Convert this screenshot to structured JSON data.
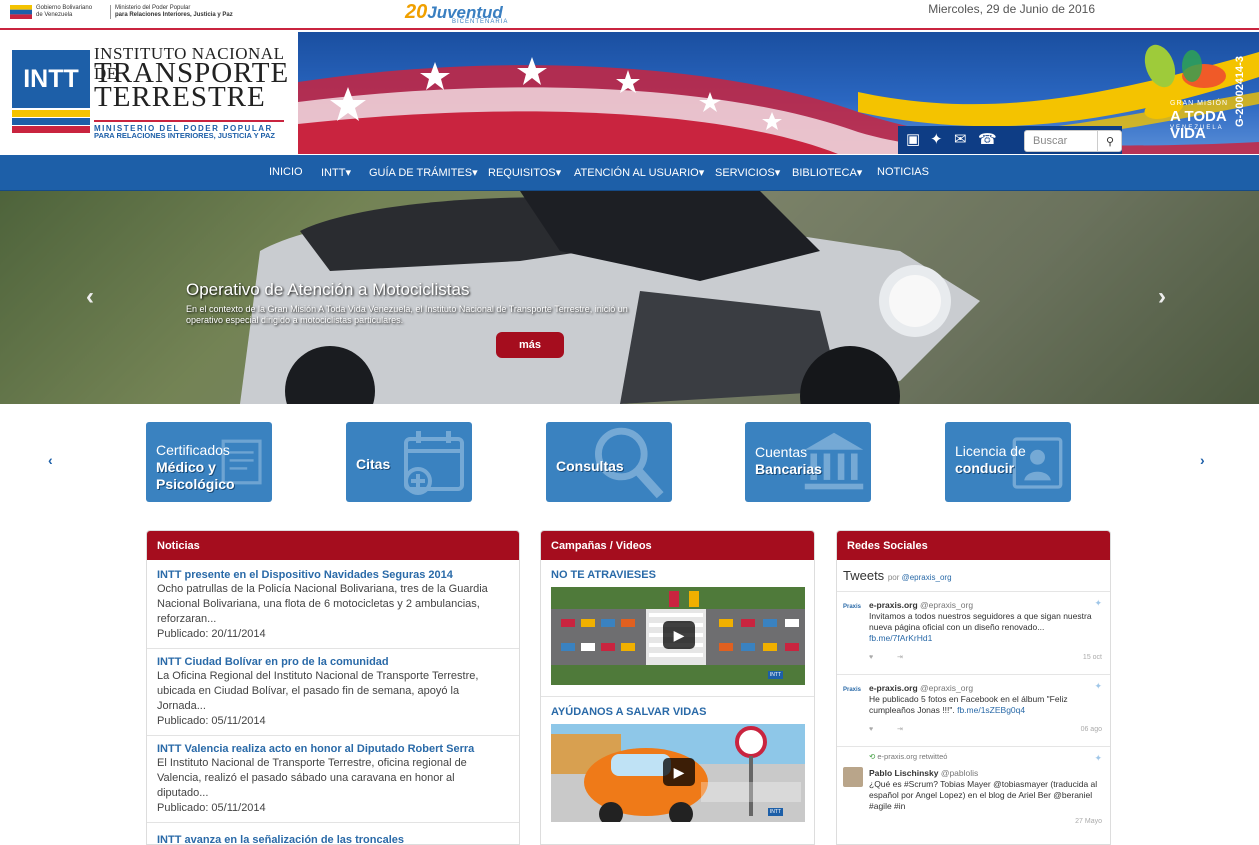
{
  "topbar": {
    "gov_line1": "Gobierno Bolivariano",
    "gov_line2": "de Venezuela",
    "ministry_line1": "Ministerio del Poder Popular",
    "ministry_line2": "para Relaciones Interiores, Justicia y Paz",
    "juventud_20": "20",
    "juventud": "Juventud",
    "bicentenaria": "BICENTENARIA",
    "date": "Miercoles, 29 de Junio de 2016"
  },
  "logo": {
    "acronym": "INTT",
    "line1": "INSTITUTO NACIONAL DE",
    "line2": "TRANSPORTE",
    "line3": "TERRESTRE",
    "line4": "MINISTERIO DEL PODER POPULAR",
    "line5": "PARA RELACIONES INTERIORES, JUSTICIA Y PAZ"
  },
  "banner": {
    "search_placeholder": "Buscar",
    "gm_line1": "GRAN MISIÓN",
    "gm_line2": "A TODA VIDA",
    "gm_line3": "VENEZUELA",
    "code": "G-20002414-3"
  },
  "nav": {
    "items": [
      "INICIO",
      "INTT",
      "GUÍA DE TRÁMITES",
      "REQUISITOS",
      "ATENCIÓN AL USUARIO",
      "SERVICIOS",
      "BIBLIOTECA",
      "NOTICIAS"
    ]
  },
  "hero": {
    "title": "Operativo de Atención a Motociclistas",
    "text": "En el contexto de la Gran Misión A Toda Vida Venezuela, el Instituto Nacional de Transporte Terrestre, inició un operativo especial dirigido a motociclistas particulares.",
    "more": "más"
  },
  "tiles": [
    {
      "line1": "Certificados",
      "line2": "Médico y",
      "line3": "Psicológico"
    },
    {
      "line1": "",
      "line2": "Citas",
      "line3": ""
    },
    {
      "line1": "",
      "line2": "Consultas",
      "line3": ""
    },
    {
      "line1": "Cuentas",
      "line2": "Bancarias",
      "line3": ""
    },
    {
      "line1": "Licencia de",
      "line2": "conducir",
      "line3": ""
    }
  ],
  "news": {
    "header": "Noticias",
    "items": [
      {
        "title": "INTT presente en el Dispositivo Navidades Seguras 2014",
        "desc": "Ocho patrullas de la Policía Nacional Bolivariana, tres de la Guardia Nacional Bolivariana, una flota de 6 motocicletas y 2 ambulancias, reforzaran...",
        "date": "Publicado: 20/11/2014"
      },
      {
        "title": "INTT Ciudad Bolívar en pro de la comunidad",
        "desc": "La Oficina Regional del Instituto Nacional de Transporte Terrestre, ubicada en Ciudad Bolívar, el pasado fin de semana, apoyó la Jornada...",
        "date": "Publicado: 05/11/2014"
      },
      {
        "title": "INTT Valencia realiza acto en honor al Diputado Robert Serra",
        "desc": "El Instituto Nacional de Transporte Terrestre, oficina regional de Valencia, realizó el pasado sábado una caravana en honor al diputado...",
        "date": "Publicado: 05/11/2014"
      },
      {
        "title": "INTT avanza en la señalización de las troncales",
        "desc": "",
        "date": ""
      }
    ]
  },
  "campaigns": {
    "header": "Campañas / Videos",
    "items": [
      {
        "title": "NO TE ATRAVIESES",
        "badge": "INTT"
      },
      {
        "title": "AYÚDANOS A SALVAR VIDAS",
        "badge": "INTT"
      }
    ]
  },
  "social": {
    "header": "Redes Sociales",
    "tweets_label": "Tweets",
    "by": "por",
    "by_handle": "@epraxis_org",
    "tweets": [
      {
        "avatar": "Praxis",
        "name": "e-praxis.org",
        "handle": "@epraxis_org",
        "text": "Invitamos a todos nuestros seguidores a que sigan nuestra nueva página oficial con un diseño renovado...",
        "link": "fb.me/7fArKrHd1",
        "time": "15 oct",
        "retweet": ""
      },
      {
        "avatar": "Praxis",
        "name": "e-praxis.org",
        "handle": "@epraxis_org",
        "text": "He publicado 5 fotos en Facebook en el álbum \"Feliz cumpleaños Jonas !!!\".",
        "link": "fb.me/1sZEBg0q4",
        "time": "06 ago",
        "retweet": ""
      },
      {
        "avatar": "",
        "name": "Pablo Lischinsky",
        "handle": "@pablolis",
        "text": "¿Qué es #Scrum? Tobias Mayer @tobiasmayer (traducida al español por Angel Lopez) en el blog de Ariel Ber @beraniel #agile #in",
        "link": "",
        "time": "27 Mayo",
        "retweet": "e-praxis.org retwitteó"
      }
    ]
  },
  "colors": {
    "brand_blue": "#1d5fa8",
    "brand_red": "#a50d1e",
    "tile_blue": "#3a82c0",
    "link_blue": "#2a6aa8"
  }
}
